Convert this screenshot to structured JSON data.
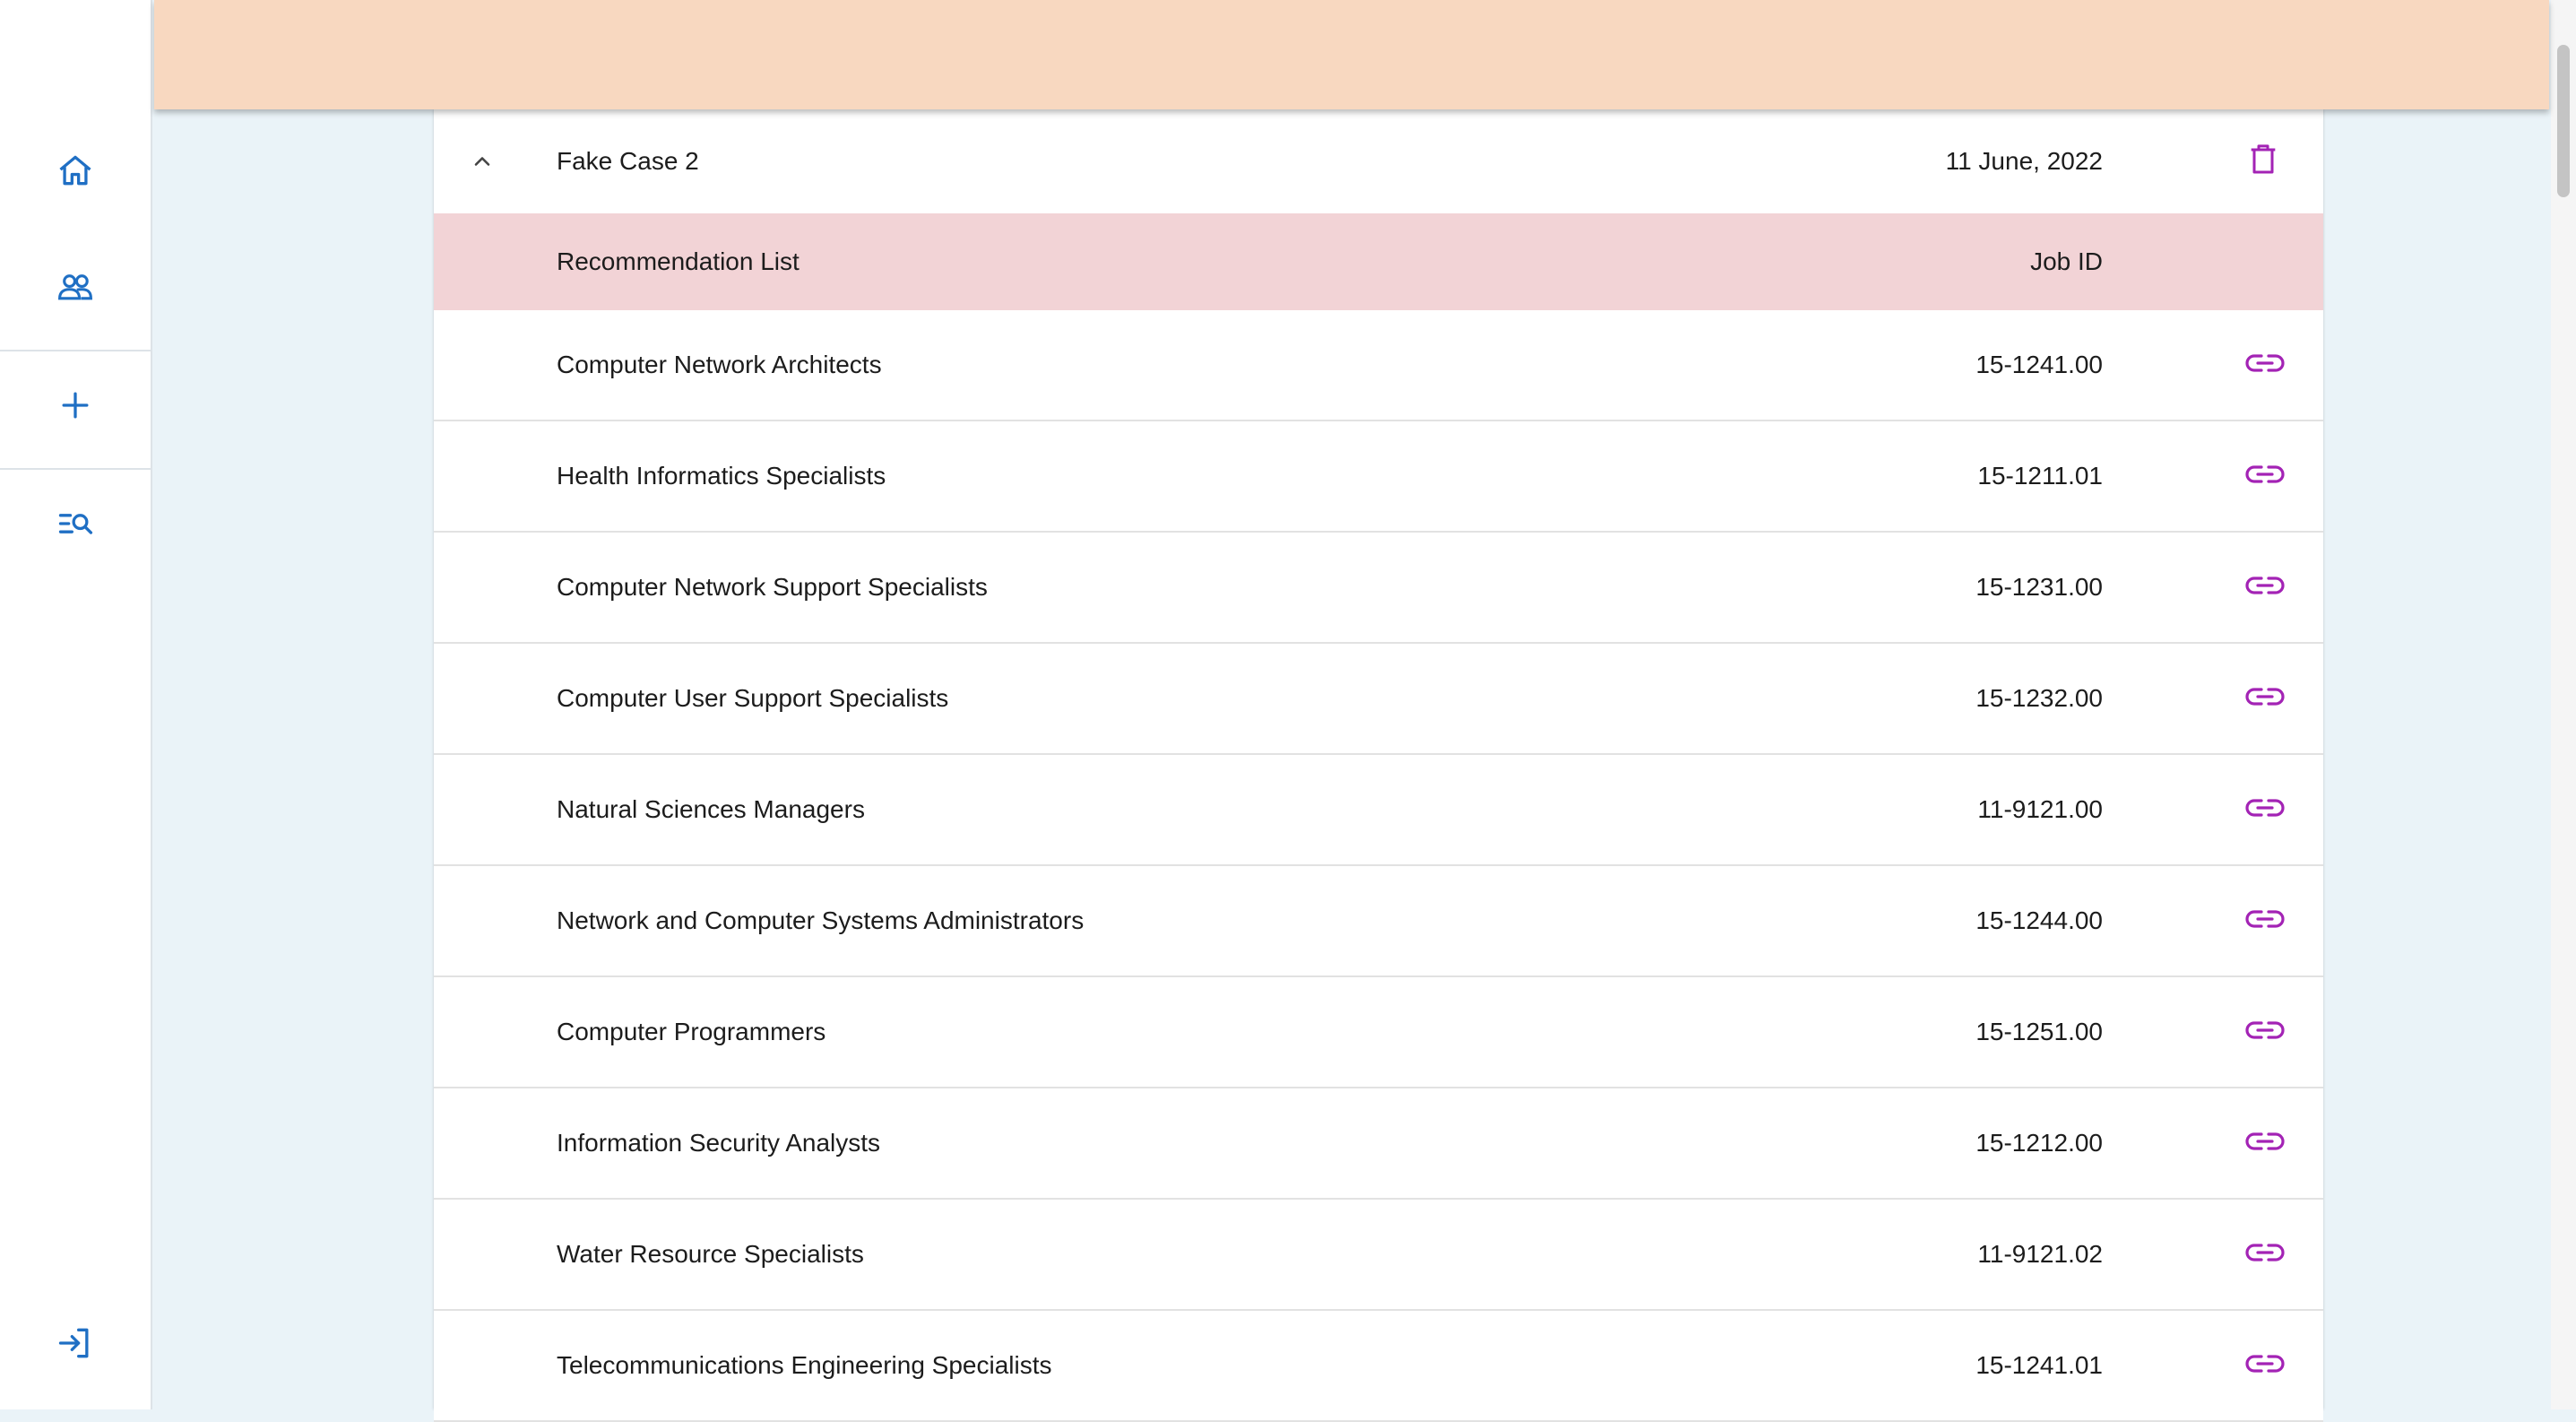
{
  "sidebar": {
    "accent_color": "#1f6fc4",
    "items": [
      {
        "name": "home",
        "icon": "home-icon"
      },
      {
        "name": "clients",
        "icon": "people-icon"
      },
      {
        "name": "add",
        "icon": "plus-icon"
      },
      {
        "name": "search-list",
        "icon": "list-search-icon"
      }
    ],
    "bottom": {
      "name": "login",
      "icon": "login-icon"
    }
  },
  "header": {
    "background": "#f8d8c0"
  },
  "case": {
    "name": "Fake Case 2",
    "date": "11 June, 2022",
    "expanded": true
  },
  "list": {
    "header_color": "#f2d3d6",
    "icon_color": "#a323b5",
    "columns": {
      "title": "Recommendation List",
      "job_id": "Job ID"
    },
    "rows": [
      {
        "title": "Computer Network Architects",
        "job_id": "15-1241.00"
      },
      {
        "title": "Health Informatics Specialists",
        "job_id": "15-1211.01"
      },
      {
        "title": "Computer Network Support Specialists",
        "job_id": "15-1231.00"
      },
      {
        "title": "Computer User Support Specialists",
        "job_id": "15-1232.00"
      },
      {
        "title": "Natural Sciences Managers",
        "job_id": "11-9121.00"
      },
      {
        "title": "Network and Computer Systems Administrators",
        "job_id": "15-1244.00"
      },
      {
        "title": "Computer Programmers",
        "job_id": "15-1251.00"
      },
      {
        "title": "Information Security Analysts",
        "job_id": "15-1212.00"
      },
      {
        "title": "Water Resource Specialists",
        "job_id": "11-9121.02"
      },
      {
        "title": "Telecommunications Engineering Specialists",
        "job_id": "15-1241.01"
      }
    ]
  }
}
